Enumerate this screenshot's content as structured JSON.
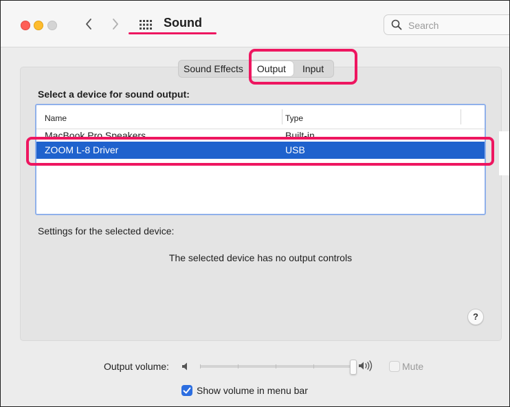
{
  "window": {
    "title": "Sound",
    "search_placeholder": "Search"
  },
  "tabs": [
    {
      "label": "Sound Effects",
      "selected": false
    },
    {
      "label": "Output",
      "selected": true
    },
    {
      "label": "Input",
      "selected": false
    }
  ],
  "device_section": {
    "heading": "Select a device for sound output:",
    "columns": [
      "Name",
      "Type"
    ],
    "rows": [
      {
        "name": "MacBook Pro Speakers",
        "type": "Built-in",
        "selected": false
      },
      {
        "name": "ZOOM L-8 Driver",
        "type": "USB",
        "selected": true
      }
    ]
  },
  "settings": {
    "label": "Settings for the selected device:",
    "message": "The selected device has no output controls",
    "help_label": "?"
  },
  "volume": {
    "label": "Output volume:",
    "level": 1.0,
    "mute_label": "Mute",
    "muted": false
  },
  "menubar": {
    "label": "Show volume in menu bar",
    "checked": true
  },
  "colors": {
    "annotation": "#ee1660",
    "selection": "#1f62cd",
    "accent": "#2c6ee0"
  }
}
